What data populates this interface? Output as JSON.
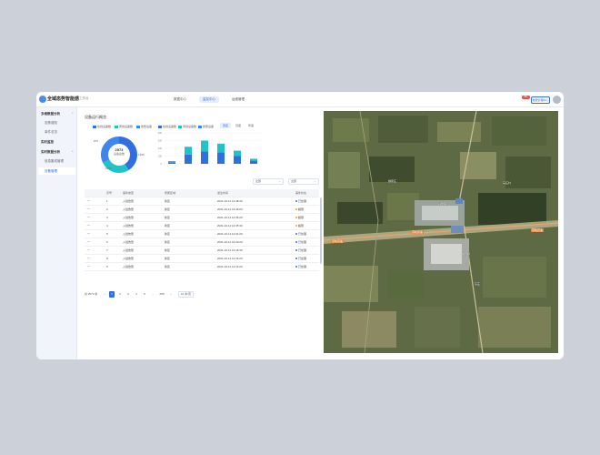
{
  "app": {
    "title": "全域态势智能感",
    "subtitle": "工作台",
    "nav_tabs": [
      {
        "label": "数据中心",
        "active": false
      },
      {
        "label": "监控中心",
        "active": true
      },
      {
        "label": "运维管理",
        "active": false
      }
    ],
    "badge": "99+",
    "user_button": "数据管理中心"
  },
  "sidebar": {
    "items": [
      {
        "label": "多维数据分析",
        "type": "group",
        "chevron": "⌃"
      },
      {
        "label": "态势感知",
        "type": "sub"
      },
      {
        "label": "事件总览",
        "type": "sub"
      },
      {
        "label": "实时监控",
        "type": "group"
      },
      {
        "label": "实时数据分析",
        "type": "group",
        "chevron": "⌃"
      },
      {
        "label": "信息集成管理",
        "type": "sub"
      },
      {
        "label": "设备管理",
        "type": "sub",
        "active": true
      }
    ]
  },
  "main": {
    "section_title": "设备运行概览",
    "donut_legend": [
      "在线设备数",
      "离线设备数",
      "告警设备"
    ],
    "donut_center_value": "2573",
    "donut_center_label": "设备总数",
    "donut_label_left_top": "875",
    "donut_label_right": "1365",
    "donut_label_bottom": "1077",
    "bar_legend": [
      "在线设备数",
      "离线设备数",
      "告警设备"
    ],
    "segments": [
      {
        "label": "周度",
        "active": true
      },
      {
        "label": "月度",
        "active": false
      },
      {
        "label": "年度",
        "active": false
      }
    ],
    "select_left": "全部",
    "select_right": "全部",
    "table": {
      "headers": [
        "",
        "序号",
        "事件类型",
        "所属区域",
        "发生时间",
        "事件状态"
      ],
      "rows": [
        {
          "dash": "一",
          "no": "1",
          "type": "入侵告警",
          "area": "新区",
          "time": "2021-10-11 14:48:40",
          "status": "已处理",
          "scolor": "#2f6fe0"
        },
        {
          "dash": "一",
          "no": "2",
          "type": "入侵告警",
          "area": "新区",
          "time": "2021-10-11 14:39:20",
          "status": "超限",
          "scolor": "#f0a030"
        },
        {
          "dash": "一",
          "no": "3",
          "type": "入侵告警",
          "area": "新区",
          "time": "2021-10-11 14:36:20",
          "status": "超限",
          "scolor": "#f0a030"
        },
        {
          "dash": "一",
          "no": "4",
          "type": "入侵告警",
          "area": "新区",
          "time": "2021-10-11 14:35:30",
          "status": "超限",
          "scolor": "#f0a030"
        },
        {
          "dash": "一",
          "no": "5",
          "type": "入侵告警",
          "area": "新区",
          "time": "2021-10-11 14:31:20",
          "status": "已处理",
          "scolor": "#2f6fe0"
        },
        {
          "dash": "一",
          "no": "6",
          "type": "入侵告警",
          "area": "新区",
          "time": "2021-10-11 14:29:20",
          "status": "已处理",
          "scolor": "#2f6fe0"
        },
        {
          "dash": "一",
          "no": "7",
          "type": "入侵告警",
          "area": "新区",
          "time": "2021-10-11 14:18:30",
          "status": "已处理",
          "scolor": "#2f6fe0"
        },
        {
          "dash": "一",
          "no": "8",
          "type": "入侵告警",
          "area": "新区",
          "time": "2021-10-11 14:16:20",
          "status": "已处理",
          "scolor": "#2f6fe0"
        },
        {
          "dash": "一",
          "no": "9",
          "type": "入侵告警",
          "area": "新区",
          "time": "2021-10-11 14:16:20",
          "status": "已处理",
          "scolor": "#2f6fe0"
        }
      ]
    },
    "pager": {
      "total": "共 2573 条",
      "pages": [
        "1",
        "2",
        "3",
        "4",
        "5"
      ],
      "ellipsis": "...",
      "last": "258",
      "next": "›",
      "size": "10 条/页"
    }
  },
  "map": {
    "labels": [
      "魏家庄",
      "兴隆镇",
      "前营村",
      "马庄村",
      "东庄"
    ],
    "road_signs": [
      "京哈高速",
      "京哈高速",
      "京哈高速"
    ]
  },
  "chart_data": [
    {
      "type": "pie",
      "categories": [
        "在线设备数",
        "离线设备数",
        "告警设备"
      ],
      "values": [
        1365,
        875,
        1077
      ],
      "colors": [
        "#2f6fe0",
        "#1fc3c8",
        "#3d86f0"
      ]
    },
    {
      "type": "bar",
      "stacked": true,
      "categories": [
        "A",
        "B",
        "C",
        "D",
        "E",
        "F"
      ],
      "series": [
        {
          "name": "在线设备数",
          "values": [
            20,
            120,
            160,
            150,
            100,
            40
          ],
          "color": "#2f6fe0"
        },
        {
          "name": "离线设备数",
          "values": [
            15,
            100,
            140,
            110,
            70,
            25
          ],
          "color": "#1fc3c8"
        }
      ],
      "ylim": [
        0,
        400
      ],
      "yticks": [
        "400",
        "300",
        "200",
        "100",
        "0"
      ]
    }
  ]
}
